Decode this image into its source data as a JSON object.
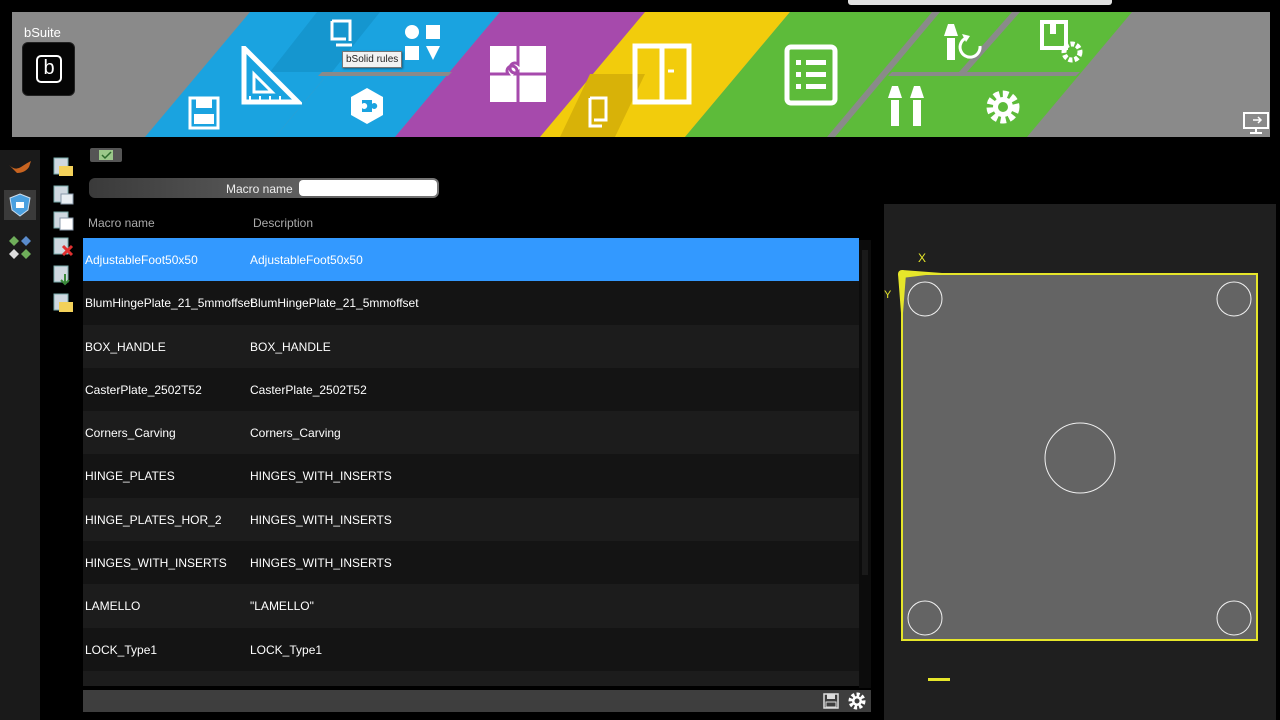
{
  "app": {
    "title": "bSuite",
    "logo_letter": "b"
  },
  "tooltip": {
    "text": "bSolid rules"
  },
  "ribbon": {
    "colors": {
      "gray": "#8a8a8a",
      "blue": "#1aa3e0",
      "purple": "#a64aac",
      "yellow": "#f2cc0c",
      "green": "#5dbb3a"
    },
    "tools": [
      {
        "name": "save-layout-icon",
        "color": "blue"
      },
      {
        "name": "ruler-triangle-icon",
        "color": "blue"
      },
      {
        "name": "bsolid-rules-icon",
        "color": "blue"
      },
      {
        "name": "puzzle-component-icon",
        "color": "blue"
      },
      {
        "name": "shapes-grid-icon",
        "color": "blue"
      },
      {
        "name": "puzzle-icon",
        "color": "purple"
      },
      {
        "name": "bracket-icon",
        "color": "yellow"
      },
      {
        "name": "cabinet-door-icon",
        "color": "yellow"
      },
      {
        "name": "list-document-icon",
        "color": "green"
      },
      {
        "name": "tool-rotate-icon",
        "color": "green"
      },
      {
        "name": "tools-icon",
        "color": "green"
      },
      {
        "name": "machine-settings-icon",
        "color": "green"
      },
      {
        "name": "gear-icon",
        "color": "green"
      },
      {
        "name": "display-exit-icon",
        "color": "gray"
      }
    ]
  },
  "filter": {
    "label": "Macro name",
    "value": ""
  },
  "table": {
    "headers": {
      "name": "Macro name",
      "description": "Description"
    },
    "selected_color": "#3399ff",
    "rows": [
      {
        "name": "AdjustableFoot50x50",
        "description": "AdjustableFoot50x50",
        "selected": true
      },
      {
        "name": "BlumHingePlate_21_5mmoffset",
        "description": "BlumHingePlate_21_5mmoffset"
      },
      {
        "name": "BOX_HANDLE",
        "description": "BOX_HANDLE"
      },
      {
        "name": "CasterPlate_2502T52",
        "description": "CasterPlate_2502T52"
      },
      {
        "name": "Corners_Carving",
        "description": "Corners_Carving"
      },
      {
        "name": "HINGE_PLATES",
        "description": "HINGES_WITH_INSERTS"
      },
      {
        "name": "HINGE_PLATES_HOR_2",
        "description": "HINGES_WITH_INSERTS"
      },
      {
        "name": "HINGES_WITH_INSERTS",
        "description": "HINGES_WITH_INSERTS"
      },
      {
        "name": "LAMELLO",
        "description": "\"LAMELLO\""
      },
      {
        "name": "LOCK_Type1",
        "description": "LOCK_Type1"
      }
    ]
  },
  "preview": {
    "axis_x_label": "X",
    "axis_y_label": "Y",
    "panel_color": "#646464",
    "outline_color": "#e6e62a"
  }
}
